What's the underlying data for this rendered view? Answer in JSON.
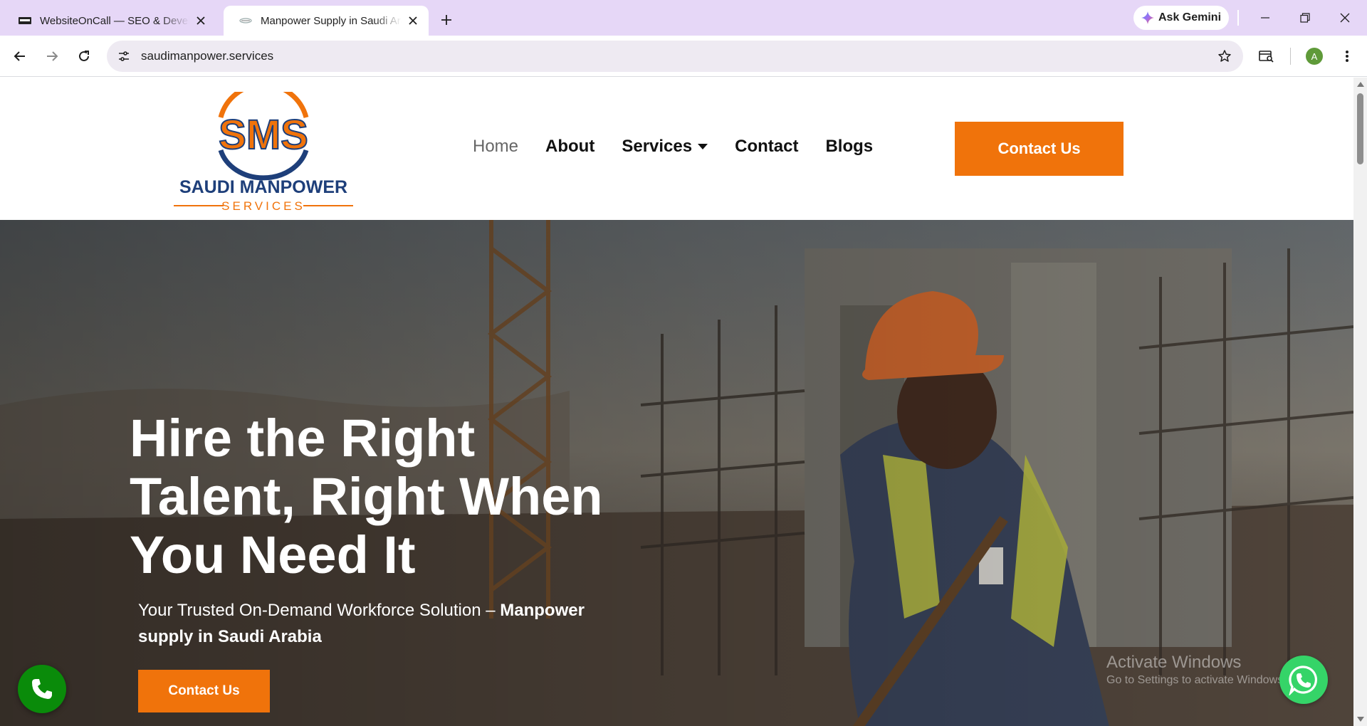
{
  "browser": {
    "tabs": [
      {
        "title": "WebsiteOnCall — SEO & Development",
        "active": false
      },
      {
        "title": "Manpower Supply in Saudi Arabia",
        "active": true
      }
    ],
    "gemini_label": "Ask Gemini",
    "url": "saudimanpower.services",
    "profile_initial": "A"
  },
  "site": {
    "logo": {
      "monogram": "SMS",
      "name": "SAUDI MANPOWER",
      "tagline": "SERVICES"
    },
    "nav": [
      {
        "label": "Home",
        "active": true
      },
      {
        "label": "About",
        "active": false
      },
      {
        "label": "Services",
        "active": false,
        "dropdown": true
      },
      {
        "label": "Contact",
        "active": false
      },
      {
        "label": "Blogs",
        "active": false
      }
    ],
    "header_cta": "Contact Us"
  },
  "hero": {
    "title_lines": [
      "Hire the Right",
      "Talent, Right When",
      "You Need It"
    ],
    "subtitle_plain": "Your Trusted On-Demand Workforce Solution – ",
    "subtitle_bold": "Manpower supply in Saudi Arabia",
    "cta": "Contact Us"
  },
  "overlay": {
    "activate_title": "Activate Windows",
    "activate_sub": "Go to Settings to activate Windows."
  },
  "colors": {
    "brand_orange": "#f0730b",
    "brand_navy": "#1e3f7a",
    "tabbar": "#e6d7f7",
    "phone_green": "#0a8b0a",
    "whatsapp_green": "#35d468"
  }
}
